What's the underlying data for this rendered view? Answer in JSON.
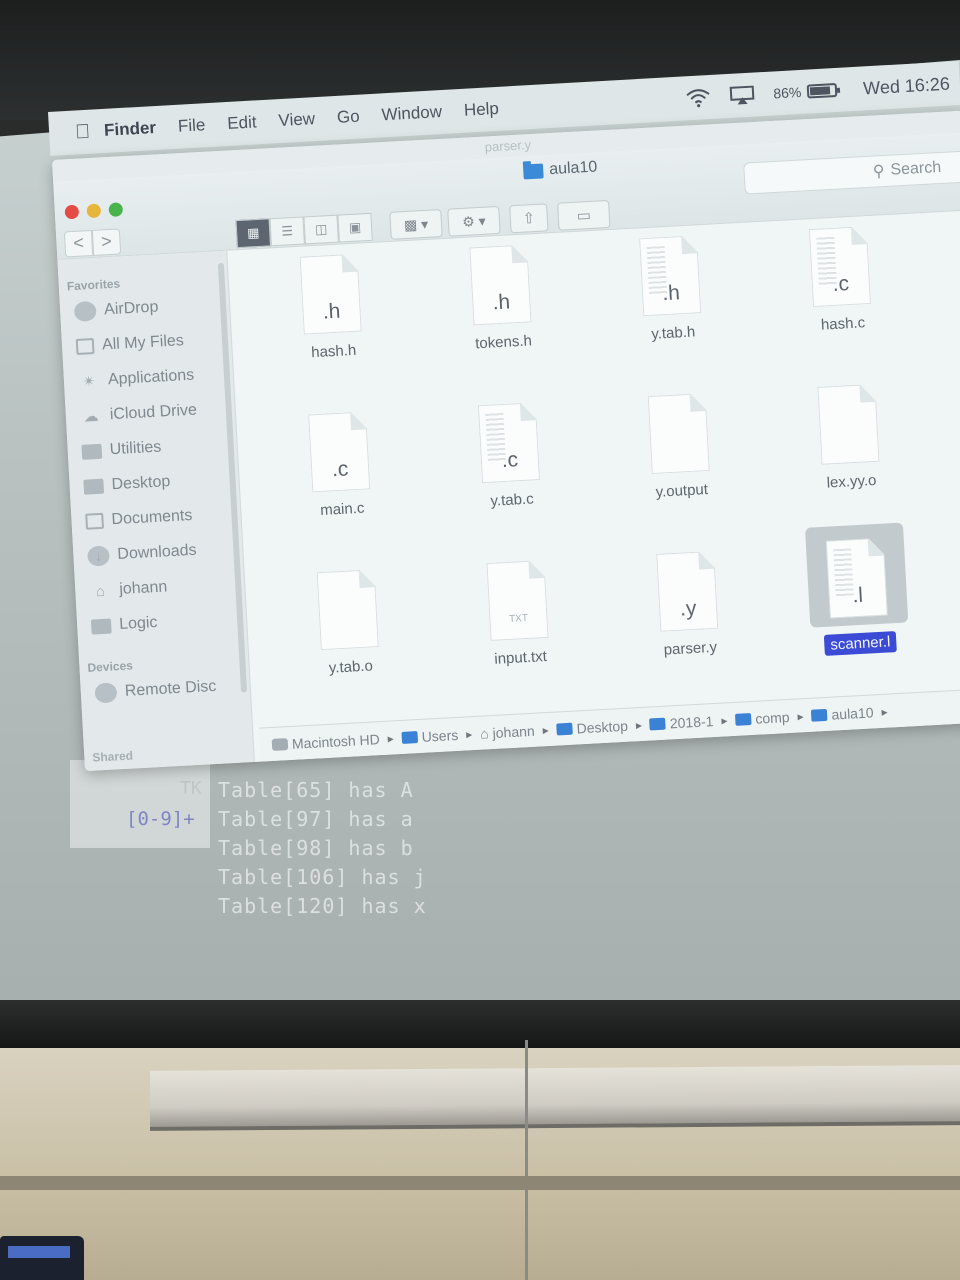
{
  "menubar": {
    "apple_icon": "apple-logo-icon",
    "app_name": "Finder",
    "items": [
      "File",
      "Edit",
      "View",
      "Go",
      "Window",
      "Help"
    ],
    "battery": "86%",
    "clock": "Wed 16:26"
  },
  "window": {
    "tab_title": "parser.y",
    "title": "aula10",
    "search_placeholder": "Search",
    "nav_back": "<",
    "nav_forward": ">"
  },
  "sidebar": {
    "favorites_heading": "Favorites",
    "items": [
      {
        "label": "AirDrop",
        "icon": "airdrop-icon"
      },
      {
        "label": "All My Files",
        "icon": "all-files-icon"
      },
      {
        "label": "Applications",
        "icon": "applications-icon"
      },
      {
        "label": "iCloud Drive",
        "icon": "cloud-icon"
      },
      {
        "label": "Utilities",
        "icon": "folder-icon"
      },
      {
        "label": "Desktop",
        "icon": "desktop-icon"
      },
      {
        "label": "Documents",
        "icon": "documents-icon"
      },
      {
        "label": "Downloads",
        "icon": "downloads-icon"
      },
      {
        "label": "johann",
        "icon": "home-icon"
      },
      {
        "label": "Logic",
        "icon": "folder-icon"
      }
    ],
    "devices_heading": "Devices",
    "devices": [
      {
        "label": "Remote Disc",
        "icon": "disc-icon"
      }
    ],
    "shared_heading": "Shared"
  },
  "files": [
    {
      "name": "hash.h",
      "ext": ".h"
    },
    {
      "name": "tokens.h",
      "ext": ".h"
    },
    {
      "name": "y.tab.h",
      "ext": ".h"
    },
    {
      "name": "hash.c",
      "ext": ".c"
    },
    {
      "name": "main.c",
      "ext": ".c"
    },
    {
      "name": "y.tab.c",
      "ext": ".c"
    },
    {
      "name": "y.output",
      "ext": ""
    },
    {
      "name": "lex.yy.o",
      "ext": ""
    },
    {
      "name": "y.tab.o",
      "ext": ""
    },
    {
      "name": "input.txt",
      "ext": "TXT"
    },
    {
      "name": "parser.y",
      "ext": ".y"
    },
    {
      "name": "scanner.l",
      "ext": ".l"
    }
  ],
  "pathbar": [
    "Macintosh HD",
    "Users",
    "johann",
    "Desktop",
    "2018-1",
    "comp",
    "aula10"
  ],
  "terminal": {
    "tk": "TK",
    "regex": "[0-9]+",
    "lines": [
      "Table[65] has A",
      "Table[97] has a",
      "Table[98] has b",
      "Table[106] has j",
      "Table[120] has x"
    ]
  }
}
